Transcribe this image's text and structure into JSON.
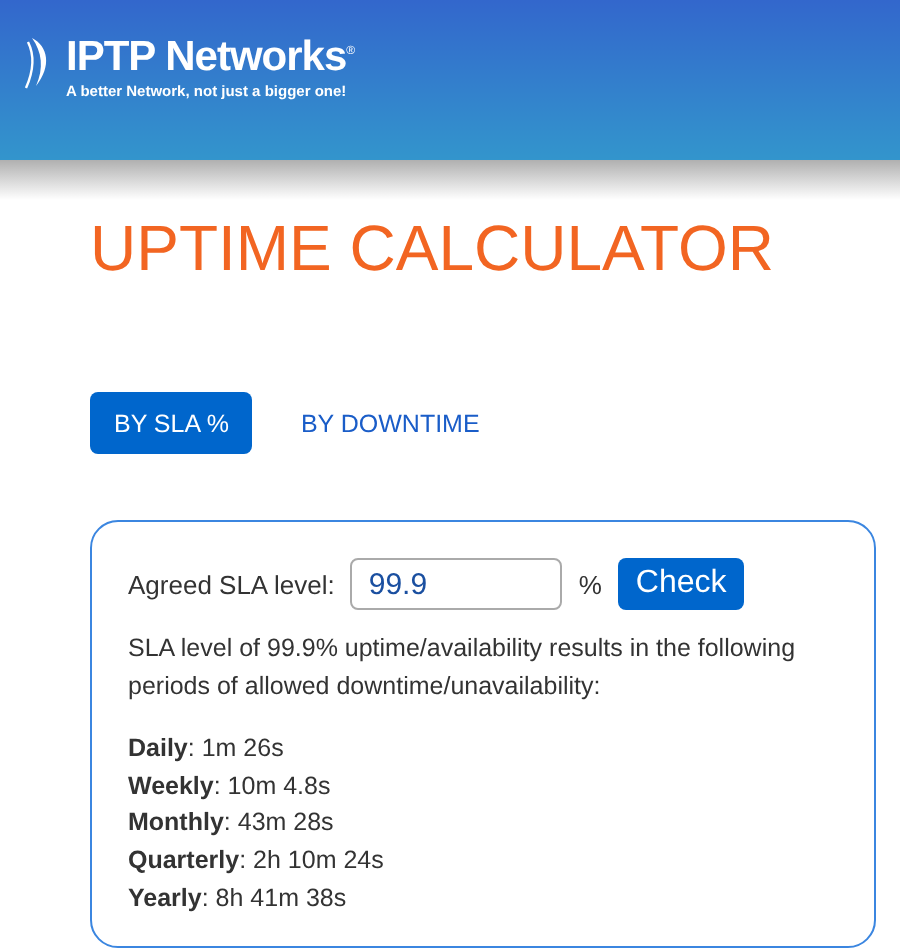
{
  "header": {
    "logo": "IPTP Networks$^{®}$",
    "tagline": "A better Network, not just a bigger one!"
  },
  "title": "UPTIME CALCULATOR",
  "tabs": [
    {
      "label": "BY SLA %",
      "selected": true
    },
    {
      "label": "BY DOWNTIME",
      "selected": false
    }
  ],
  "form": {
    "label": "Agreed SLA level:",
    "value": "99.9",
    "unit": "%",
    "button": "Check"
  },
  "summary": "SLA level of 99.9% uptime/availability results in the following periods of allowed downtime/unavailability:",
  "results": [
    "**Daily**: 1m 26s",
    "**Weekly**: 10m 4.8s",
    "**Monthly**: 43m 28s",
    "**Quarterly**: 2h 10m 24s",
    "**Yearly**: 8h 41m 38s"
  ]
}
